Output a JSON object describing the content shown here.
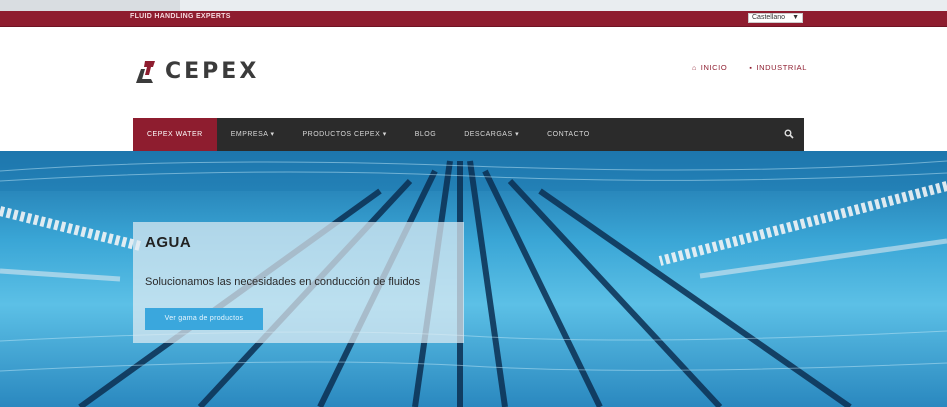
{
  "topbar": {
    "text": "FLUID HANDLING EXPERTS",
    "language_select": "Castellano"
  },
  "header": {
    "logo_text": "CEPEX",
    "links": [
      {
        "label": "INICIO",
        "icon": "home-icon"
      },
      {
        "label": "INDUSTRIAL",
        "icon": "factory-icon"
      }
    ]
  },
  "nav": {
    "items": [
      {
        "label": "CEPEX WATER",
        "active": true
      },
      {
        "label": "EMPRESA ▾",
        "active": false
      },
      {
        "label": "PRODUCTOS CEPEX ▾",
        "active": false
      },
      {
        "label": "BLOG",
        "active": false
      },
      {
        "label": "DESCARGAS ▾",
        "active": false
      },
      {
        "label": "CONTACTO",
        "active": false
      }
    ],
    "search_icon": "search-icon"
  },
  "hero": {
    "title": "AGUA",
    "subtitle": "Solucionamos las necesidades en conducción de fluidos",
    "button_label": "Ver gama de productos"
  },
  "colors": {
    "brand_red": "#8e1d2f",
    "nav_dark": "#2b2b2b",
    "accent_blue": "#3aa7dd"
  }
}
